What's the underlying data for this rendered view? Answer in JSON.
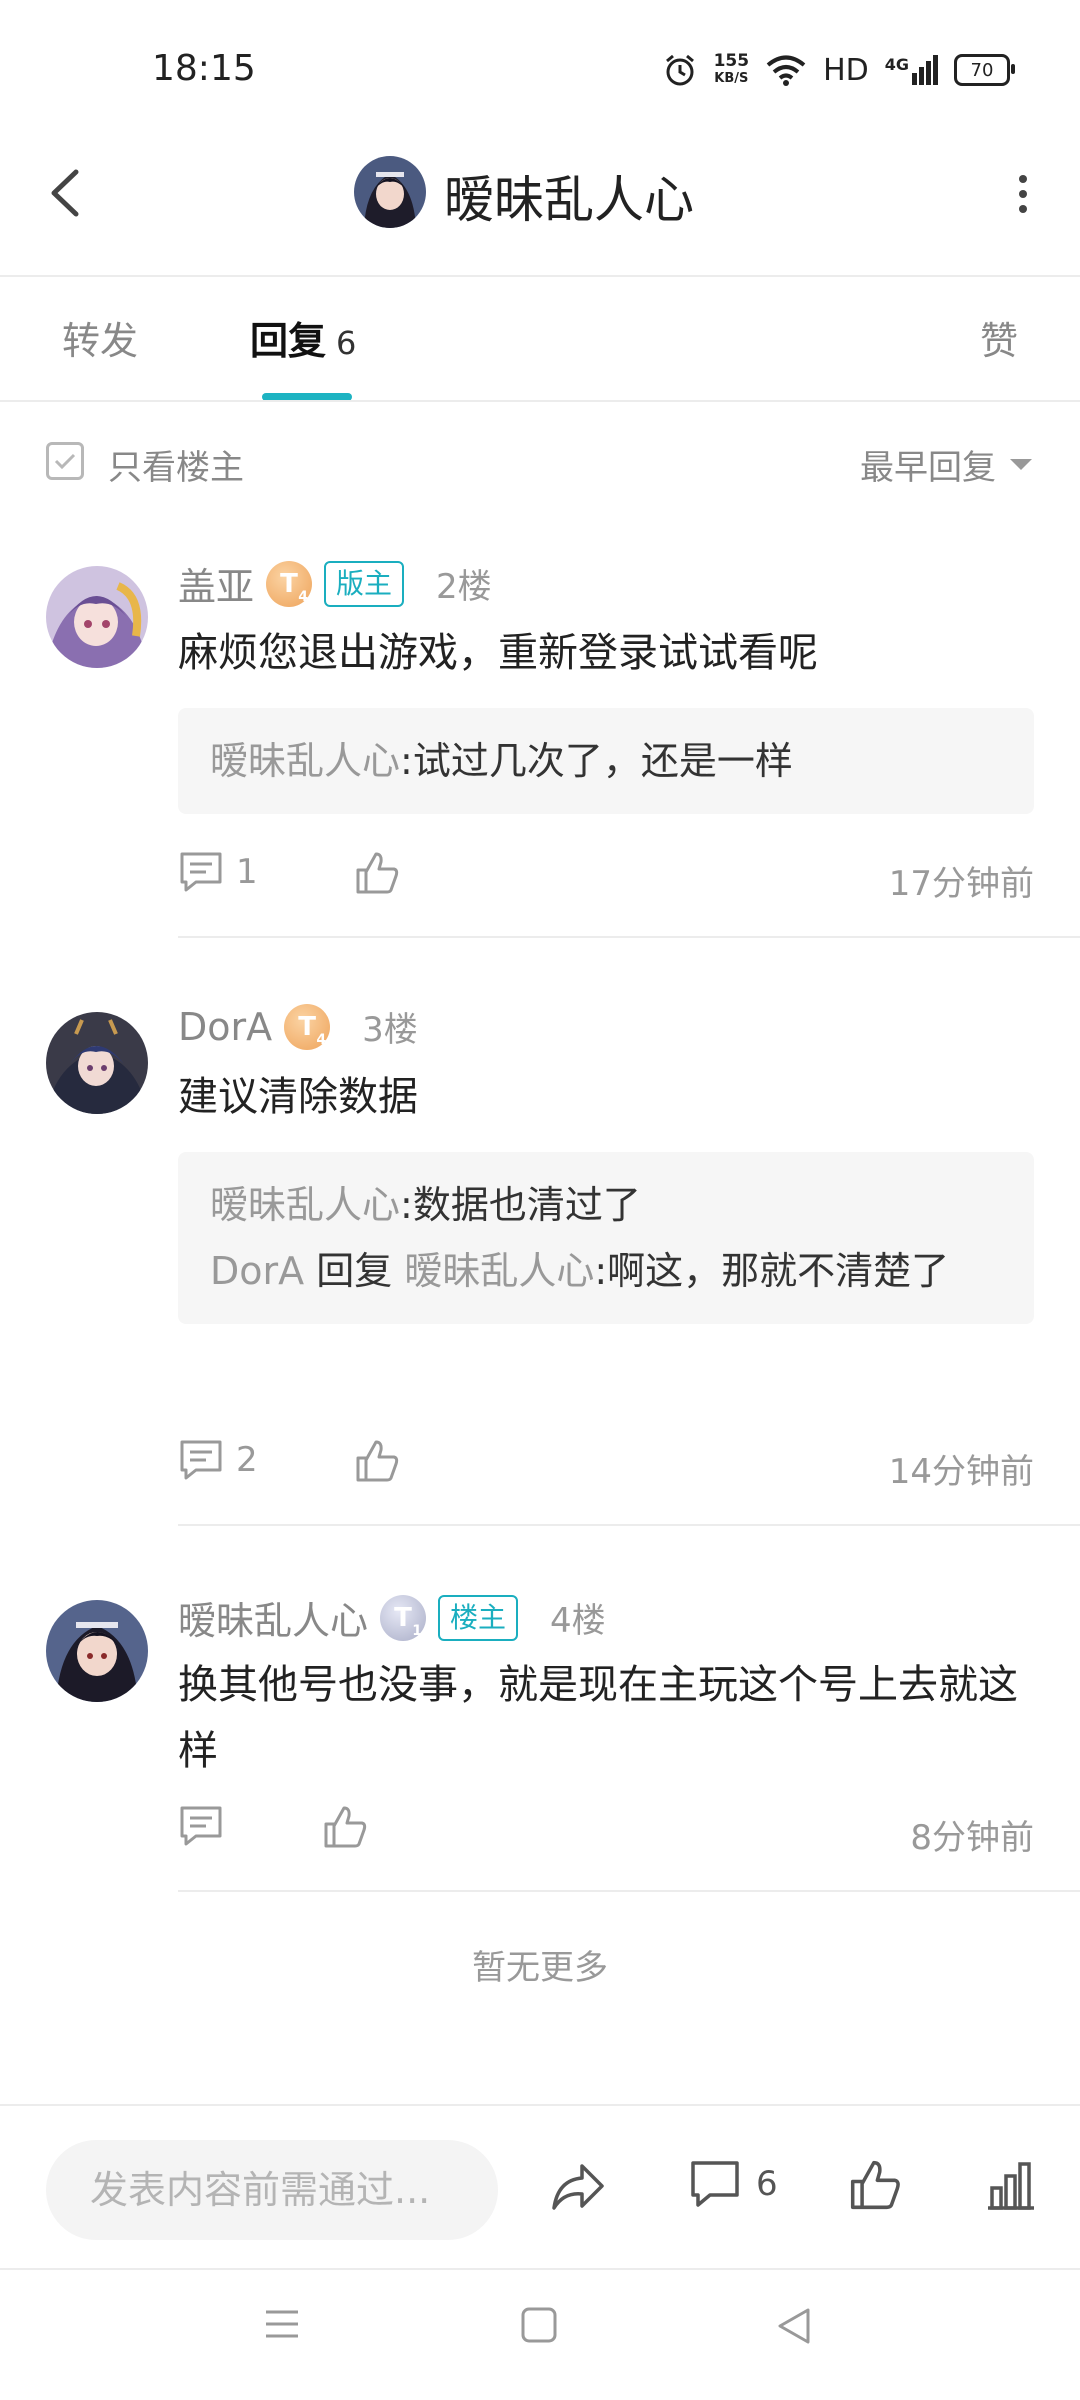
{
  "status_bar": {
    "time": "18:15",
    "net_speed_value": "155",
    "net_speed_unit": "KB/S",
    "hd_label": "HD",
    "signal_label": "4G",
    "battery": "70"
  },
  "header": {
    "title": "暧昧乱人心"
  },
  "tabs": [
    {
      "label": "转发"
    },
    {
      "label": "回复",
      "count": "6"
    },
    {
      "label": "赞"
    }
  ],
  "filter": {
    "only_op_label": "只看楼主",
    "sort_label": "最早回复"
  },
  "replies": [
    {
      "username": "盖亚",
      "level": "T",
      "level_sub": "4",
      "badge": "版主",
      "floor": "2楼",
      "content": "麻烦您退出游戏，重新登录试试看呢",
      "quotes": [
        {
          "name": "暧昧乱人心",
          "text": ":试过几次了，还是一样"
        }
      ],
      "comment_count": "1",
      "time": "17分钟前"
    },
    {
      "username": "DorA",
      "level": "T",
      "level_sub": "4",
      "floor": "3楼",
      "content": "建议清除数据",
      "quotes": [
        {
          "name": "暧昧乱人心",
          "text": ":数据也清过了"
        },
        {
          "name": "DorA",
          "reply_word": "回复",
          "target": "暧昧乱人心",
          "text": ":啊这，那就不清楚了"
        }
      ],
      "comment_count": "2",
      "time": "14分钟前"
    },
    {
      "username": "暧昧乱人心",
      "level": "T",
      "level_sub": "1",
      "badge": "楼主",
      "floor": "4楼",
      "content": "换其他号也没事，就是现在主玩这个号上去就这样",
      "time": "8分钟前"
    }
  ],
  "no_more": "暂无更多",
  "composer": {
    "placeholder": "发表内容前需通过...",
    "comment_count": "6"
  },
  "colors": {
    "accent": "#1db3c2",
    "muted_text": "#999999",
    "gold_level": "#eea35a",
    "silver_level": "#a9adc7"
  }
}
